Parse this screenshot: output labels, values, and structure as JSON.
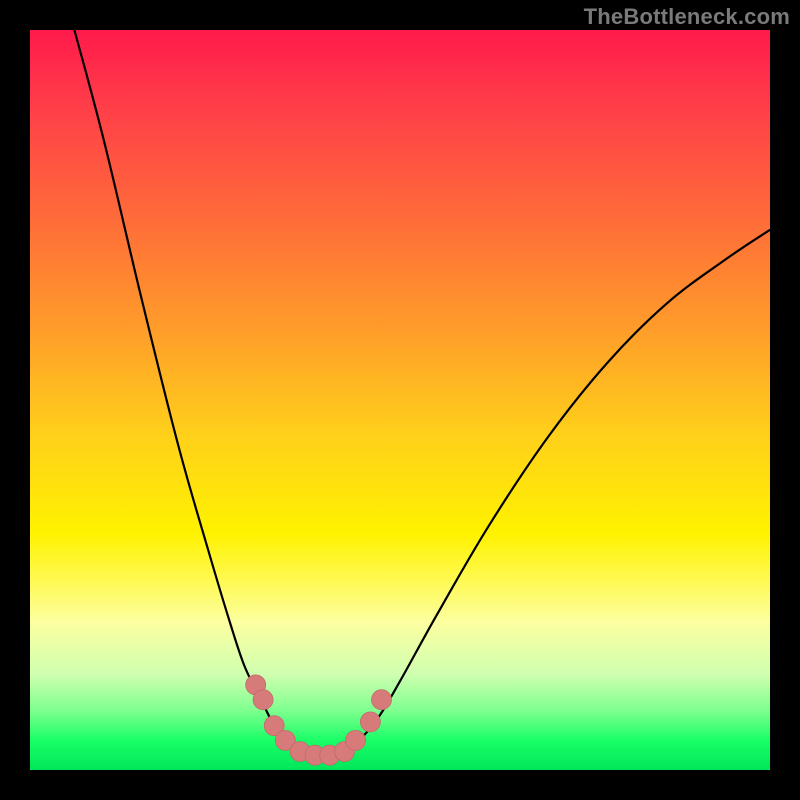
{
  "watermark": "TheBottleneck.com",
  "chart_data": {
    "type": "line",
    "title": "",
    "xlabel": "",
    "ylabel": "",
    "xlim": [
      0,
      100
    ],
    "ylim": [
      0,
      100
    ],
    "grid": false,
    "legend": false,
    "series": [
      {
        "name": "left-curve",
        "x": [
          6,
          10,
          15,
          20,
          24,
          27,
          29,
          31,
          33,
          35,
          37
        ],
        "y": [
          100,
          85,
          64,
          44,
          30,
          20,
          14,
          10,
          6,
          3.5,
          2
        ]
      },
      {
        "name": "right-curve",
        "x": [
          42,
          44,
          47,
          50,
          55,
          62,
          70,
          78,
          86,
          94,
          100
        ],
        "y": [
          2,
          3.5,
          7,
          12,
          21,
          33,
          45,
          55,
          63,
          69,
          73
        ]
      },
      {
        "name": "markers",
        "type": "scatter",
        "points": [
          {
            "x": 30.5,
            "y": 11.5
          },
          {
            "x": 31.5,
            "y": 9.5
          },
          {
            "x": 33.0,
            "y": 6.0
          },
          {
            "x": 34.5,
            "y": 4.0
          },
          {
            "x": 36.5,
            "y": 2.5
          },
          {
            "x": 38.5,
            "y": 2.0
          },
          {
            "x": 40.5,
            "y": 2.0
          },
          {
            "x": 42.5,
            "y": 2.5
          },
          {
            "x": 44.0,
            "y": 4.0
          },
          {
            "x": 46.0,
            "y": 6.5
          },
          {
            "x": 47.5,
            "y": 9.5
          }
        ]
      }
    ],
    "colors": {
      "top_gradient": "#ff1a4b",
      "bottom_gradient": "#00e65a",
      "curve_stroke": "#000000",
      "marker_fill": "#d67a7a"
    }
  }
}
